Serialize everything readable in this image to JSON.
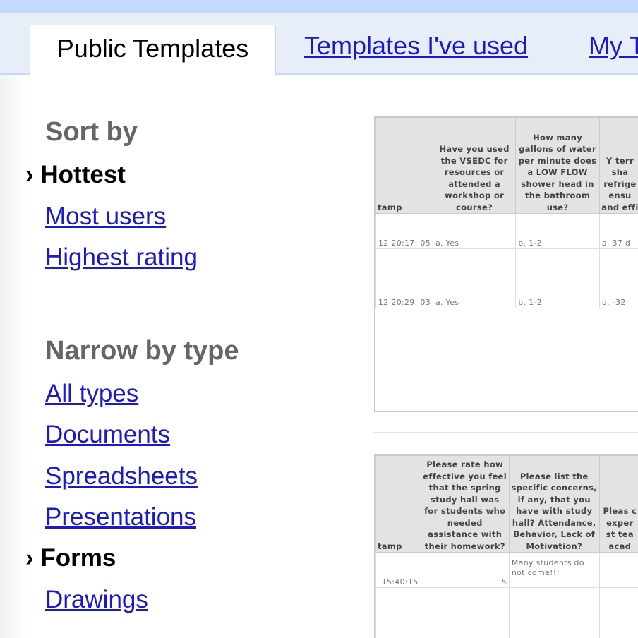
{
  "tabs": {
    "public_templates": "Public Templates",
    "templates_used": "Templates I've used",
    "my_templates": "My T"
  },
  "sidebar": {
    "sort_heading": "Sort by",
    "sort_items": [
      {
        "label": "Hottest",
        "selected": true
      },
      {
        "label": "Most users",
        "selected": false
      },
      {
        "label": "Highest rating",
        "selected": false
      }
    ],
    "type_heading": "Narrow by type",
    "type_items": [
      {
        "label": "All types",
        "selected": false
      },
      {
        "label": "Documents",
        "selected": false
      },
      {
        "label": "Spreadsheets",
        "selected": false
      },
      {
        "label": "Presentations",
        "selected": false
      },
      {
        "label": "Forms",
        "selected": true
      },
      {
        "label": "Drawings",
        "selected": false
      }
    ],
    "selected_marker": "›"
  },
  "templates": [
    {
      "headers": [
        "tamp",
        "Have you used the VSEDC for resources or attended a workshop or course?",
        "How many gallons of water per minute does a LOW FLOW shower head in the bathroom use?",
        "Y terr sha refrige ensu and effi"
      ],
      "rows": [
        [
          "12 20:17: 05",
          "a. Yes",
          "b. 1-2",
          "a. 37 d"
        ],
        [
          "12 20:29: 03",
          "a. Yes",
          "b. 1-2",
          "d. -32"
        ]
      ]
    },
    {
      "headers": [
        "tamp",
        "Please rate how effective you feel that the spring study hall was for students who needed assistance with their homework?",
        "Please list the specific concerns, if any, that you have with study hall? Attendance, Behavior, Lack of Motivation?",
        "Pleas c exper st tea acad"
      ],
      "rows": [
        [
          "15:40:15",
          "5",
          "Many students do not come!!!",
          ""
        ]
      ]
    }
  ],
  "colors": {
    "link": "#1a1acc",
    "tab_bar": "#e8eef7",
    "top_bar": "#c3d9ff",
    "heading_gray": "#666666"
  }
}
